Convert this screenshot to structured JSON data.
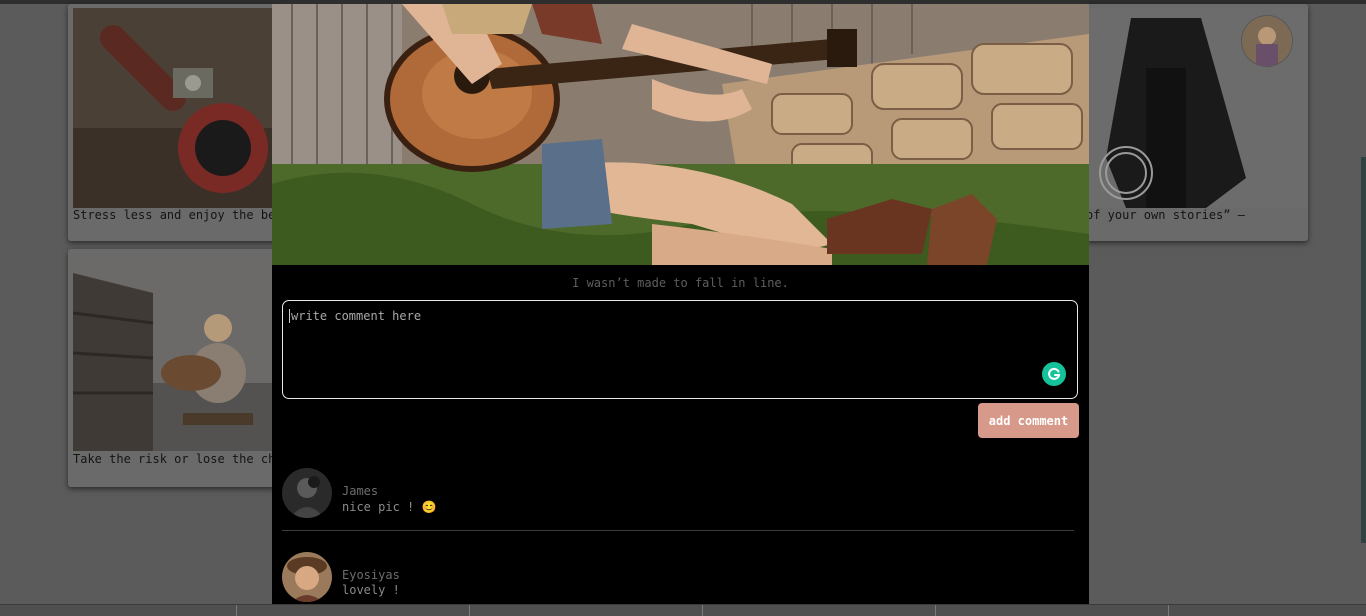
{
  "background_cards": [
    {
      "caption": "Stress less and enjoy the be"
    },
    {
      "caption": "Take the risk or lose the ch"
    },
    {
      "caption": "of your own stories” –"
    }
  ],
  "modal": {
    "caption": "I wasn’t made to fall in line.",
    "comment_placeholder": "write comment here",
    "add_comment_label": "add comment",
    "comments": [
      {
        "name": "James",
        "text": "nice pic ! 😊"
      },
      {
        "name": "Eyosiyas",
        "text": "lovely !"
      }
    ]
  },
  "colors": {
    "overlay": "#5b5b5b",
    "modal_bg": "#000000",
    "button": "#d7998a",
    "grammarly": "#15c39a"
  },
  "icons": [
    "grammarly-icon",
    "user-avatar"
  ]
}
